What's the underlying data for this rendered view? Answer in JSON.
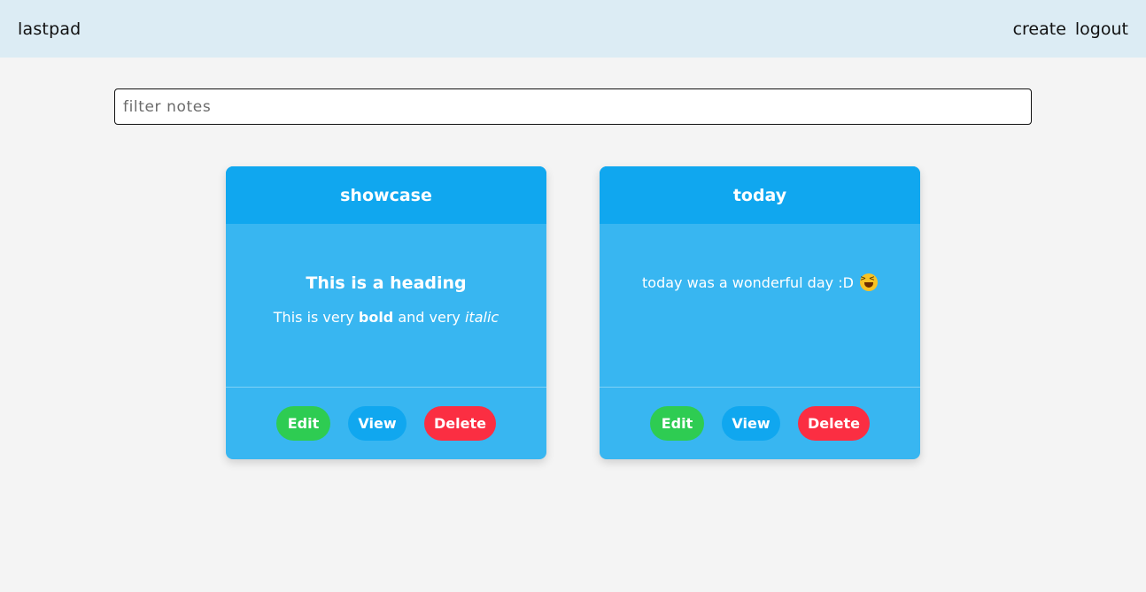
{
  "header": {
    "brand": "lastpad",
    "nav": [
      {
        "label": "create"
      },
      {
        "label": "logout"
      }
    ]
  },
  "filter": {
    "placeholder": "filter notes",
    "value": ""
  },
  "notes": [
    {
      "title": "showcase",
      "heading": "This is a heading",
      "text_parts": [
        "This is very ",
        "bold",
        " and very ",
        "italic"
      ],
      "actions": {
        "edit": "Edit",
        "view": "View",
        "delete": "Delete"
      }
    },
    {
      "title": "today",
      "text": "today was a wonderful day :D",
      "emoji_icon": "laughing-face-icon",
      "actions": {
        "edit": "Edit",
        "view": "View",
        "delete": "Delete"
      }
    }
  ],
  "colors": {
    "header_bg": "#dcecf4",
    "card_header": "#10a7ef",
    "card_body": "#38b6f1",
    "edit": "#2ecc52",
    "view": "#10a7ef",
    "delete": "#fb2e42"
  }
}
